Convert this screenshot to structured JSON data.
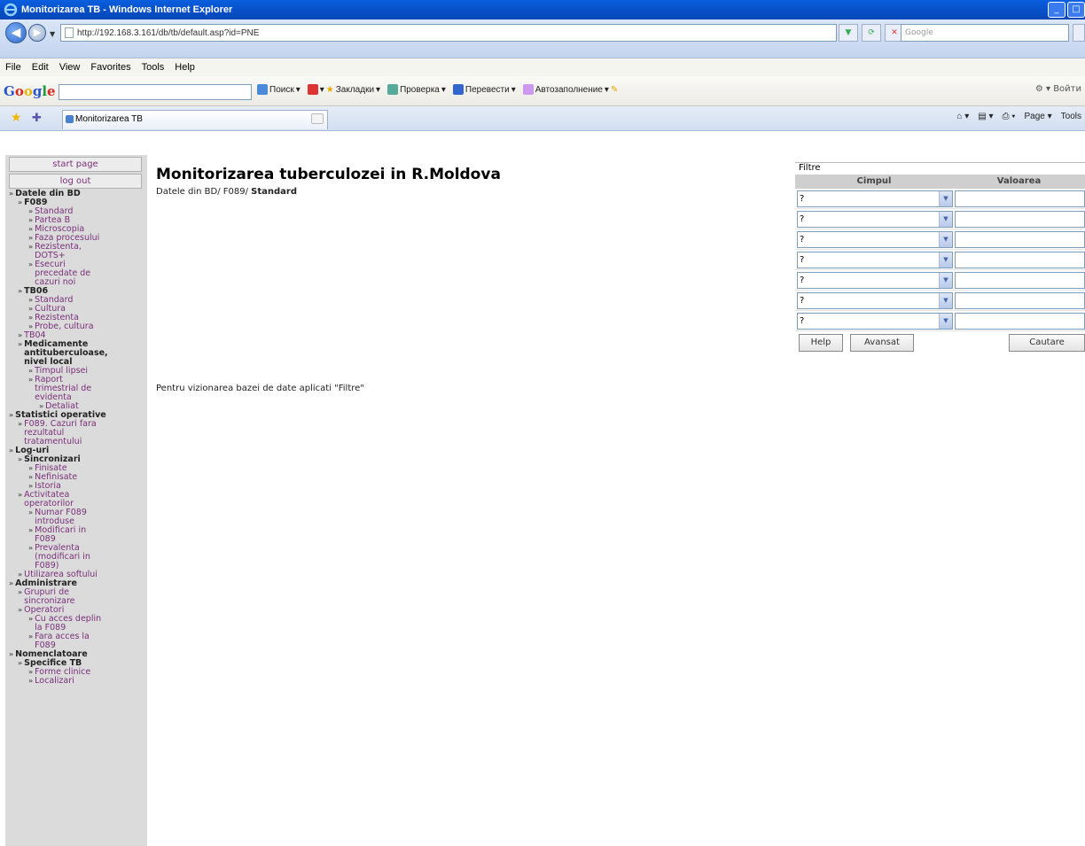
{
  "window": {
    "title": "Monitorizarea TB - Windows Internet Explorer"
  },
  "address": {
    "url": "http://192.168.3.161/db/tb/default.asp?id=PNE",
    "search_placeholder": "Google"
  },
  "menu": [
    "File",
    "Edit",
    "View",
    "Favorites",
    "Tools",
    "Help"
  ],
  "google_toolbar": {
    "logo": [
      "G",
      "o",
      "o",
      "g",
      "l",
      "e"
    ],
    "items": [
      "Поиск",
      "Закладки",
      "Проверка",
      "Перевести",
      "Автозаполнение"
    ],
    "right": "Войти"
  },
  "tabs": {
    "active": "Monitorizarea TB",
    "right_items": [
      "Page",
      "Tools"
    ]
  },
  "sidebar": {
    "start_page": "start page",
    "log_out": "log out",
    "tree": [
      {
        "d": 0,
        "t": "Datele din BD",
        "h": true
      },
      {
        "d": 1,
        "t": "F089",
        "h": true
      },
      {
        "d": 2,
        "t": "Standard"
      },
      {
        "d": 2,
        "t": "Partea B"
      },
      {
        "d": 2,
        "t": "Microscopia"
      },
      {
        "d": 2,
        "t": "Faza procesului"
      },
      {
        "d": 2,
        "t": "Rezistenta,",
        "t2": "DOTS+"
      },
      {
        "d": 2,
        "t": "Esecuri",
        "t2": "precedate de",
        "t3": "cazuri noi"
      },
      {
        "d": 1,
        "t": "TB06",
        "h": true
      },
      {
        "d": 2,
        "t": "Standard"
      },
      {
        "d": 2,
        "t": "Cultura"
      },
      {
        "d": 2,
        "t": "Rezistenta"
      },
      {
        "d": 2,
        "t": "Probe, cultura"
      },
      {
        "d": 1,
        "t": "TB04"
      },
      {
        "d": 1,
        "t": "Medicamente",
        "t2": "antituberculoase,",
        "t3": "nivel local",
        "h": true
      },
      {
        "d": 2,
        "t": "Timpul lipsei"
      },
      {
        "d": 2,
        "t": "Raport",
        "t2": "trimestrial de",
        "t3": "evidenta"
      },
      {
        "d": 3,
        "t": "Detaliat"
      },
      {
        "d": 0,
        "t": "Statistici operative",
        "h": true
      },
      {
        "d": 1,
        "t": "F089. Cazuri fara",
        "t2": "rezultatul",
        "t3": "tratamentului"
      },
      {
        "d": 0,
        "t": "Log-uri",
        "h": true
      },
      {
        "d": 1,
        "t": "Sincronizari",
        "h": true
      },
      {
        "d": 2,
        "t": "Finisate"
      },
      {
        "d": 2,
        "t": "Nefinisate"
      },
      {
        "d": 2,
        "t": "Istoria"
      },
      {
        "d": 1,
        "t": "Activitatea",
        "t2": "operatorilor"
      },
      {
        "d": 2,
        "t": "Numar F089",
        "t2": "introduse"
      },
      {
        "d": 2,
        "t": "Modificari in",
        "t2": "F089"
      },
      {
        "d": 2,
        "t": "Prevalenta",
        "t2": "(modificari in",
        "t3": "F089)"
      },
      {
        "d": 1,
        "t": "Utilizarea softului"
      },
      {
        "d": 0,
        "t": "Administrare",
        "h": true
      },
      {
        "d": 1,
        "t": "Grupuri de",
        "t2": "sincronizare"
      },
      {
        "d": 1,
        "t": "Operatori"
      },
      {
        "d": 2,
        "t": "Cu acces deplin",
        "t2": "la F089"
      },
      {
        "d": 2,
        "t": "Fara acces la",
        "t2": "F089"
      },
      {
        "d": 0,
        "t": "Nomenclatoare",
        "h": true
      },
      {
        "d": 1,
        "t": "Specifice TB",
        "h": true
      },
      {
        "d": 2,
        "t": "Forme clinice"
      },
      {
        "d": 2,
        "t": "Localizari"
      }
    ]
  },
  "main": {
    "title": "Monitorizarea tuberculozei in R.Moldova",
    "breadcrumb_prefix": "Datele din BD/ F089/",
    "breadcrumb_current": "Standard",
    "hint": "Pentru vizionarea bazei de date aplicati \"Filtre\""
  },
  "filter": {
    "title": "Filtre",
    "col_field": "Cimpul",
    "col_value": "Valoarea",
    "rows": [
      "?",
      "?",
      "?",
      "?",
      "?",
      "?",
      "?"
    ],
    "help": "Help",
    "advanced": "Avansat",
    "search": "Cautare"
  }
}
